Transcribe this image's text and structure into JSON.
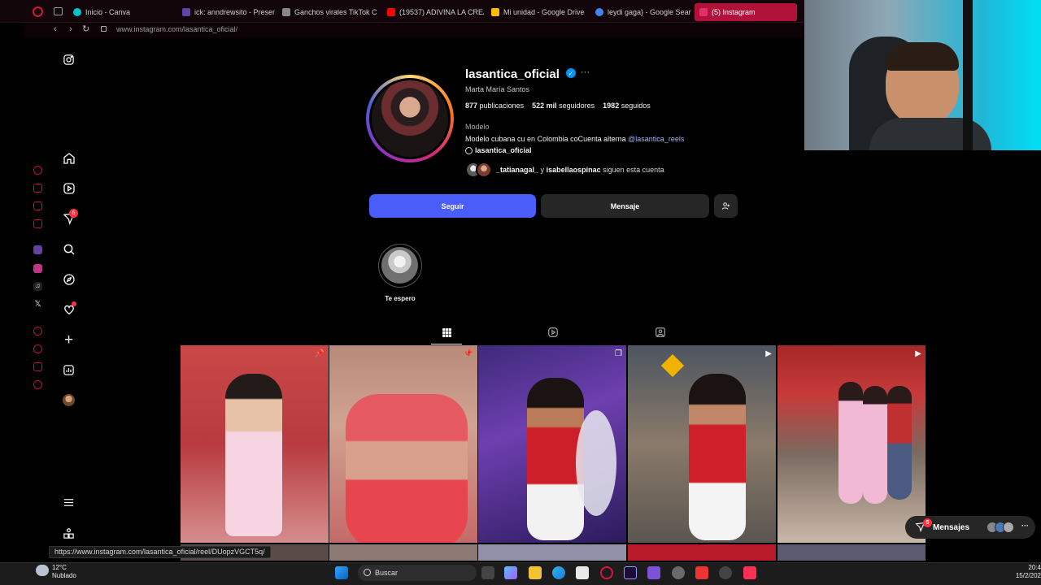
{
  "browser": {
    "tabs": [
      {
        "label": "Inicio - Canva",
        "color": "#00c4cc"
      },
      {
        "label": "ick: anndrewsito - Presen",
        "color": "#6441a5"
      },
      {
        "label": "Ganchos virales TikTok C",
        "color": "#888888"
      },
      {
        "label": "(19537) ADIVINA LA CREA",
        "color": "#ff0000"
      },
      {
        "label": "Mi unidad - Google Drive",
        "color": "#fbbc04"
      },
      {
        "label": "leydi gaga} - Google Sear",
        "color": "#4285f4"
      },
      {
        "label": "(5) Instagram",
        "color": "#e1306c"
      }
    ],
    "url": "www.instagram.com/lasantica_oficial/",
    "status_url": "https://www.instagram.com/lasantica_oficial/reel/DUopzVGCT5q/"
  },
  "nav": {
    "notifications_badge": "6"
  },
  "profile": {
    "username": "lasantica_oficial",
    "fullname": "Marta María Santos",
    "stats": {
      "posts": "877",
      "posts_label": "publicaciones",
      "followers": "522 mil",
      "followers_label": "seguidores",
      "following": "1982",
      "following_label": "seguidos"
    },
    "category": "Modelo",
    "bio_text": "Modelo cubana cu en Colombia coCuenta alterna",
    "bio_link": "@lasantica_reels",
    "threads_handle": "lasantica_oficial",
    "followed_by_1": "_tatianagal_",
    "followed_by_sep": "y",
    "followed_by_2": "isabellaospinac",
    "followed_by_suffix": "siguen esta cuenta",
    "follow_button": "Seguir",
    "message_button": "Mensaje",
    "highlight_label": "Te espero"
  },
  "messages": {
    "label": "Mensajes",
    "badge": "5"
  },
  "taskbar": {
    "search_placeholder": "Buscar",
    "weather_temp": "12°C",
    "weather_desc": "Nublado",
    "time": "20:4",
    "date": "15/2/202"
  }
}
